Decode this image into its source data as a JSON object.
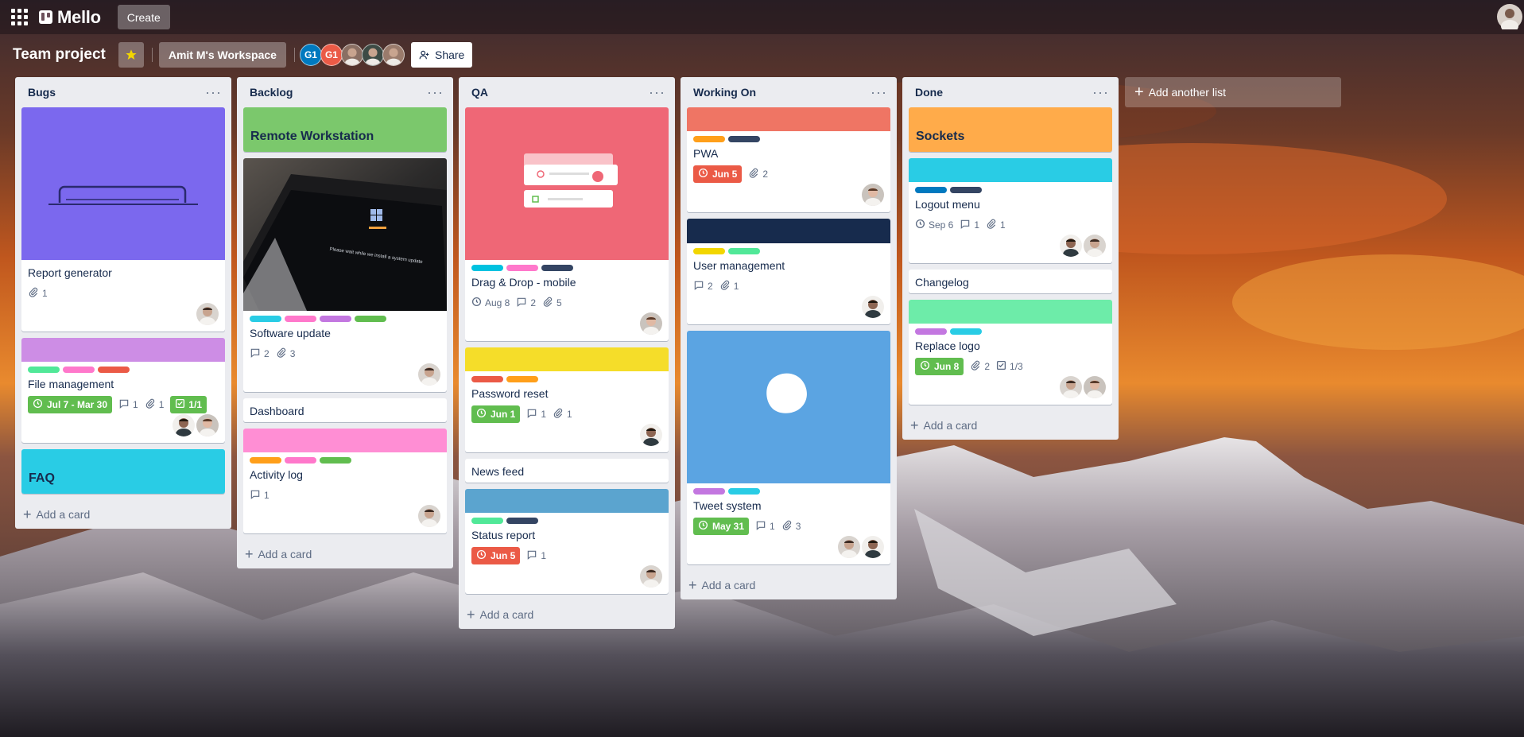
{
  "app": {
    "name": "Mello",
    "create_label": "Create"
  },
  "board": {
    "title": "Team project",
    "workspace": "Amit M's Workspace",
    "share_label": "Share",
    "members": [
      {
        "initials": "G1",
        "color": "#0079bf"
      },
      {
        "initials": "G1",
        "color": "#eb5a46"
      },
      {
        "initials": "",
        "color": "#8a6f63"
      },
      {
        "initials": "",
        "color": "#3d4b45"
      },
      {
        "initials": "",
        "color": "#9a7b6c"
      }
    ]
  },
  "add_another_list": "Add another list",
  "add_card_label": "Add a card",
  "lists": [
    {
      "title": "Bugs",
      "cards": [
        {
          "cover": "#7b68ee",
          "title": "Report generator",
          "attachments": "1"
        },
        {
          "cover": "#cd8de5",
          "labels": [
            "#51e898",
            "#ff78cb",
            "#eb5a46"
          ],
          "title": "File management",
          "due": "Jul 7 - Mar 30",
          "comments": "1",
          "attachments": "1",
          "checklist": "1/1"
        },
        {
          "cover": "#29cce5",
          "cover_title": "FAQ"
        }
      ]
    },
    {
      "title": "Backlog",
      "cards": [
        {
          "cover": "#7bc86c",
          "cover_title": "Remote Workstation"
        },
        {
          "photo_caption": "Please wait while we install a system update",
          "labels": [
            "#29cce5",
            "#ff78cb",
            "#c377e0",
            "#61bd4f"
          ],
          "title": "Software update",
          "comments": "2",
          "attachments": "3"
        },
        {
          "title": "Dashboard"
        },
        {
          "cover": "#ff8ed4",
          "labels": [
            "#ff9f1a",
            "#ff78cb",
            "#61bd4f"
          ],
          "title": "Activity log",
          "comments": "1"
        }
      ]
    },
    {
      "title": "QA",
      "cards": [
        {
          "cover": "#ef6776",
          "labels": [
            "#00c2e0",
            "#ff78cb",
            "#344563"
          ],
          "title": "Drag & Drop - mobile",
          "date": "Aug 8",
          "comments": "2",
          "attachments": "5"
        },
        {
          "cover": "#f5dd29",
          "labels": [
            "#eb5a46",
            "#ff9f1a"
          ],
          "title": "Password reset",
          "due": "Jun 1",
          "comments": "1",
          "attachments": "1"
        },
        {
          "title": "News feed"
        },
        {
          "cover": "#5ba4cf",
          "labels": [
            "#51e898",
            "#344563"
          ],
          "title": "Status report",
          "due": "Jun 5",
          "comments": "1"
        }
      ]
    },
    {
      "title": "Working On",
      "cards": [
        {
          "cover": "#ef7564",
          "labels": [
            "#ff9f1a",
            "#344563"
          ],
          "title": "PWA",
          "due": "Jun 5",
          "attachments": "2"
        },
        {
          "cover": "#172b4d",
          "labels": [
            "#f2d600",
            "#51e898"
          ],
          "title": "User management",
          "comments": "2",
          "attachments": "1"
        },
        {
          "cover": "#5ba4e2",
          "labels": [
            "#c377e0",
            "#29cce5"
          ],
          "title": "Tweet system",
          "due": "May 31",
          "comments": "1",
          "attachments": "3"
        }
      ]
    },
    {
      "title": "Done",
      "cards": [
        {
          "cover": "#ffab4a",
          "cover_title": "Sockets"
        },
        {
          "cover": "#29cce5",
          "labels": [
            "#0079bf",
            "#344563"
          ],
          "title": "Logout menu",
          "date": "Sep 6",
          "comments": "1",
          "attachments": "1"
        },
        {
          "title": "Changelog"
        },
        {
          "cover": "#6deca9",
          "labels": [
            "#c377e0",
            "#29cce5"
          ],
          "title": "Replace logo",
          "due": "Jun 8",
          "attachments": "2",
          "checklist": "1/3"
        }
      ]
    }
  ]
}
